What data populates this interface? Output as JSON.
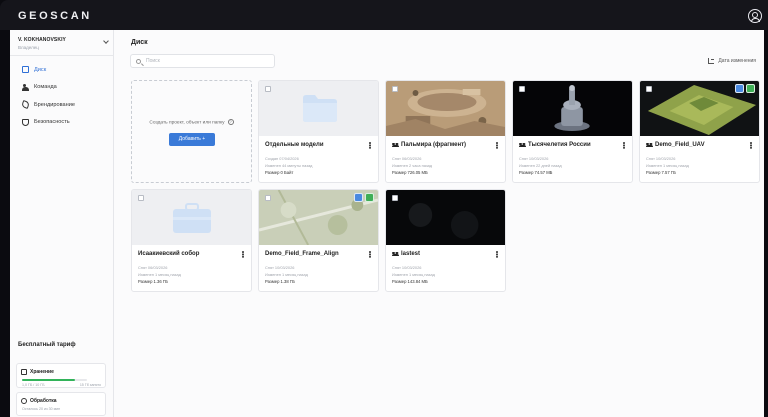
{
  "app": {
    "logo": "GEOSCAN"
  },
  "account": {
    "name": "V. KOKHANOVSKIY",
    "subtitle": "Владелец"
  },
  "nav": [
    {
      "label": "Диск",
      "icon": "folder-icon",
      "active": true
    },
    {
      "label": "Команда",
      "icon": "team-icon",
      "active": false
    },
    {
      "label": "Брендирование",
      "icon": "brush-icon",
      "active": false
    },
    {
      "label": "Безопасность",
      "icon": "shield-icon",
      "active": false
    }
  ],
  "plan": {
    "title": "Бесплатный тариф",
    "storage": {
      "label": "Хранение",
      "used": "1,0 ГБ / 10 ГБ",
      "left": "15 Гб занято",
      "progress": 0.82
    },
    "processing": {
      "label": "Обработка",
      "sub": "Осталось 20 из 30 мин"
    }
  },
  "main": {
    "title": "Диск",
    "search_placeholder": "Поиск",
    "sort_label": "Дата изменения",
    "create": {
      "text": "Создать проект, объект или папку",
      "button": "Добавить +"
    }
  },
  "cards": [
    {
      "title": "Отдельные модели",
      "shared": false,
      "meta1": "Создан 07/04/2026",
      "meta2": "Изменен 44 минуты назад",
      "size": "Размер 0 Байт",
      "thumb": "folder",
      "badges": []
    },
    {
      "title": "Пальмира (фрагмент)",
      "shared": true,
      "meta1": "Снят 06/03/2026",
      "meta2": "Изменен 2 часа назад",
      "size": "Размер 726.05 МБ",
      "thumb": "palmyra",
      "badges": []
    },
    {
      "title": "Тысячелетия России",
      "shared": true,
      "meta1": "Снят 10/03/2026",
      "meta2": "Изменен 22 дней назад",
      "size": "Размер 74.57 МБ",
      "thumb": "monument",
      "badges": []
    },
    {
      "title": "Demo_Field_UAV",
      "shared": true,
      "meta1": "Снят 10/03/2026",
      "meta2": "Изменен 1 месяц назад",
      "size": "Размер 7.57 ГБ",
      "thumb": "field",
      "badges": [
        "blue",
        "green"
      ]
    },
    {
      "title": "Исаакиевский собор",
      "shared": false,
      "meta1": "Снят 06/03/2026",
      "meta2": "Изменен 1 месяц назад",
      "size": "Размер 1.36 ГБ",
      "thumb": "case",
      "badges": []
    },
    {
      "title": "Demo_Field_Frame_Align",
      "shared": false,
      "meta1": "Снят 10/03/2026",
      "meta2": "Изменен 1 месяц назад",
      "size": "Размер 1.38 ГБ",
      "thumb": "aerial",
      "badges": [
        "blue",
        "green"
      ]
    },
    {
      "title": "lastest",
      "shared": true,
      "meta1": "Снят 10/03/2026",
      "meta2": "Изменен 1 месяц назад",
      "size": "Размер 143.84 МБ",
      "thumb": "dark",
      "badges": []
    }
  ]
}
